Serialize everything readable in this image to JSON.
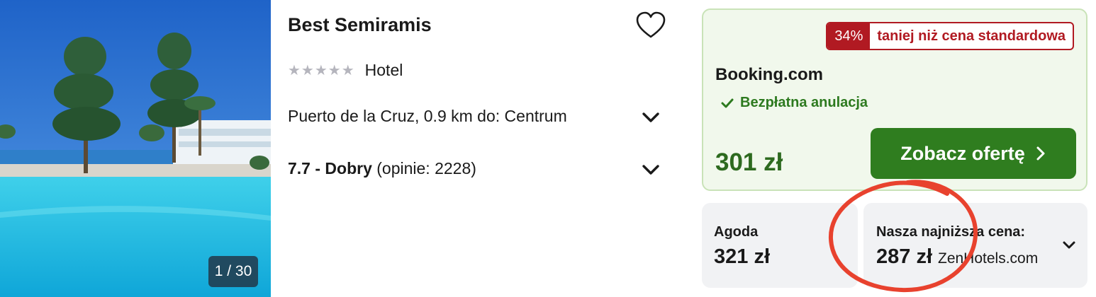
{
  "hotel": {
    "name": "Best Semiramis",
    "stars": "★★★★★",
    "type": "Hotel",
    "location": "Puerto de la Cruz, 0.9 km do: Centrum",
    "rating_score": "7.7 - Dobry",
    "rating_reviews": "(opinie: 2228)"
  },
  "photo": {
    "counter": "1 / 30"
  },
  "deal": {
    "discount_pct": "34%",
    "discount_text": "taniej niż cena standardowa",
    "provider": "Booking.com",
    "cancellation": "Bezpłatna anulacja",
    "price": "301 zł",
    "cta_label": "Zobacz ofertę"
  },
  "offers": [
    {
      "provider": "Agoda",
      "price": "321 zł"
    },
    {
      "label": "Nasza najniższa cena:",
      "price": "287 zł",
      "provider": "ZenHotels.com"
    }
  ],
  "colors": {
    "deal_bg": "#f1f8ec",
    "deal_border": "#c9e3b8",
    "accent_green": "#2f7d1f",
    "badge_red": "#b11a22",
    "annotation_red": "#e8422e",
    "offer_bg": "#f1f2f4"
  },
  "icons": [
    "heart-icon",
    "chevron-down-icon",
    "check-icon",
    "chevron-right-icon"
  ]
}
